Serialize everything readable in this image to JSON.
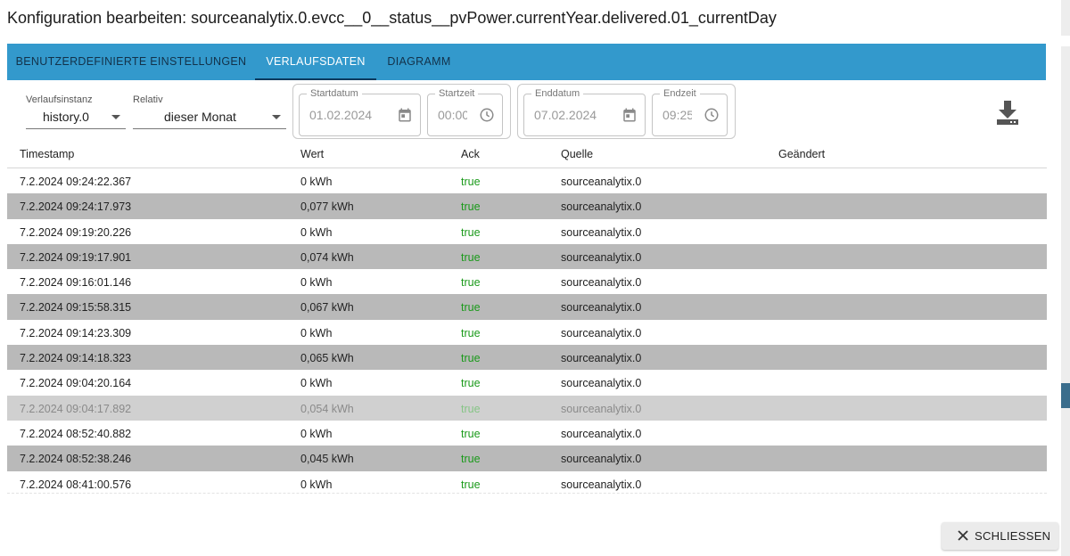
{
  "dialog": {
    "title": "Konfiguration bearbeiten: sourceanalytix.0.evcc__0__status__pvPower.currentYear.delivered.01_currentDay",
    "close_label": "SCHLIESSEN"
  },
  "tabs": [
    {
      "label": "BENUTZERDEFINIERTE EINSTELLUNGEN",
      "active": false
    },
    {
      "label": "VERLAUFSDATEN",
      "active": true
    },
    {
      "label": "DIAGRAMM",
      "active": false
    }
  ],
  "filters": {
    "instance_label": "Verlaufsinstanz",
    "instance_value": "history.0",
    "relative_label": "Relativ",
    "relative_value": "dieser Monat",
    "start_date_label": "Startdatum",
    "start_date_value": "01.02.2024",
    "start_time_label": "Startzeit",
    "start_time_value": "00:00",
    "end_date_label": "Enddatum",
    "end_date_value": "07.02.2024",
    "end_time_label": "Endzeit",
    "end_time_value": "09:25"
  },
  "icons": {
    "calendar": "calendar-icon",
    "clock": "clock-icon",
    "download": "download-icon",
    "close": "close-icon"
  },
  "colors": {
    "tab_bar": "#3399cc",
    "ack_true": "#1a9a1a",
    "row_alt": "#b9b9b9",
    "row_highlight": "#d0d0d0"
  },
  "table": {
    "headers": [
      "Timestamp",
      "Wert",
      "Ack",
      "Quelle",
      "Geändert"
    ],
    "rows": [
      {
        "timestamp": "7.2.2024 09:24:22.367",
        "value": "0 kWh",
        "ack": "true",
        "source": "sourceanalytix.0",
        "changed": ""
      },
      {
        "timestamp": "7.2.2024 09:24:17.973",
        "value": "0,077 kWh",
        "ack": "true",
        "source": "sourceanalytix.0",
        "changed": ""
      },
      {
        "timestamp": "7.2.2024 09:19:20.226",
        "value": "0 kWh",
        "ack": "true",
        "source": "sourceanalytix.0",
        "changed": ""
      },
      {
        "timestamp": "7.2.2024 09:19:17.901",
        "value": "0,074 kWh",
        "ack": "true",
        "source": "sourceanalytix.0",
        "changed": ""
      },
      {
        "timestamp": "7.2.2024 09:16:01.146",
        "value": "0 kWh",
        "ack": "true",
        "source": "sourceanalytix.0",
        "changed": ""
      },
      {
        "timestamp": "7.2.2024 09:15:58.315",
        "value": "0,067 kWh",
        "ack": "true",
        "source": "sourceanalytix.0",
        "changed": ""
      },
      {
        "timestamp": "7.2.2024 09:14:23.309",
        "value": "0 kWh",
        "ack": "true",
        "source": "sourceanalytix.0",
        "changed": ""
      },
      {
        "timestamp": "7.2.2024 09:14:18.323",
        "value": "0,065 kWh",
        "ack": "true",
        "source": "sourceanalytix.0",
        "changed": ""
      },
      {
        "timestamp": "7.2.2024 09:04:20.164",
        "value": "0 kWh",
        "ack": "true",
        "source": "sourceanalytix.0",
        "changed": ""
      },
      {
        "timestamp": "7.2.2024 09:04:17.892",
        "value": "0,054 kWh",
        "ack": "true",
        "source": "sourceanalytix.0",
        "changed": ""
      },
      {
        "timestamp": "7.2.2024 08:52:40.882",
        "value": "0 kWh",
        "ack": "true",
        "source": "sourceanalytix.0",
        "changed": ""
      },
      {
        "timestamp": "7.2.2024 08:52:38.246",
        "value": "0,045 kWh",
        "ack": "true",
        "source": "sourceanalytix.0",
        "changed": ""
      },
      {
        "timestamp": "7.2.2024 08:41:00.576",
        "value": "0 kWh",
        "ack": "true",
        "source": "sourceanalytix.0",
        "changed": ""
      }
    ]
  }
}
